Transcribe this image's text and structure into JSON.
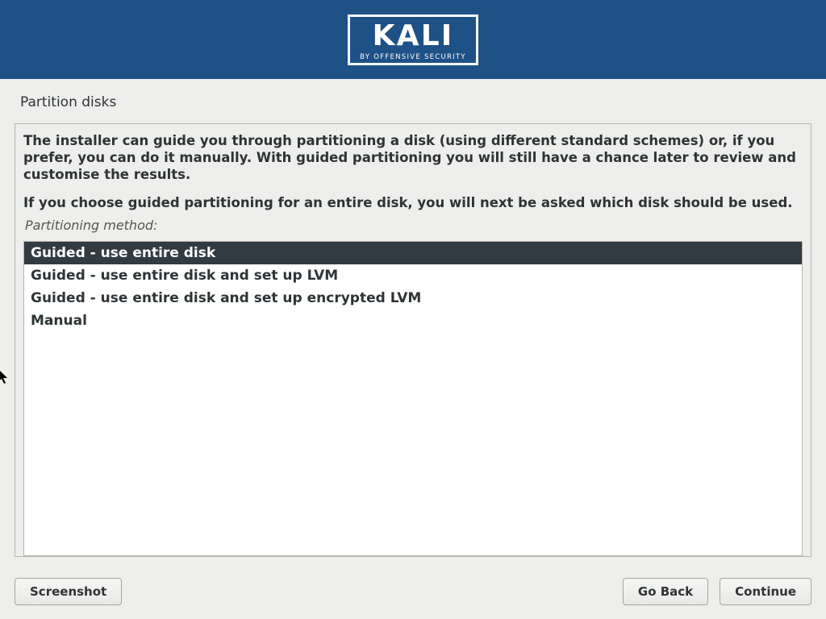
{
  "logo": {
    "main": "KALI",
    "subtitle": "BY OFFENSIVE SECURITY"
  },
  "page_title": "Partition disks",
  "panel": {
    "paragraph1": "The installer can guide you through partitioning a disk (using different standard schemes) or, if you prefer, you can do it manually. With guided partitioning you will still have a chance later to review and customise the results.",
    "paragraph2": "If you choose guided partitioning for an entire disk, you will next be asked which disk should be used.",
    "method_label": "Partitioning method:",
    "options": [
      "Guided - use entire disk",
      "Guided - use entire disk and set up LVM",
      "Guided - use entire disk and set up encrypted LVM",
      "Manual"
    ],
    "selected_index": 0
  },
  "buttons": {
    "screenshot": "Screenshot",
    "go_back": "Go Back",
    "continue": "Continue"
  }
}
